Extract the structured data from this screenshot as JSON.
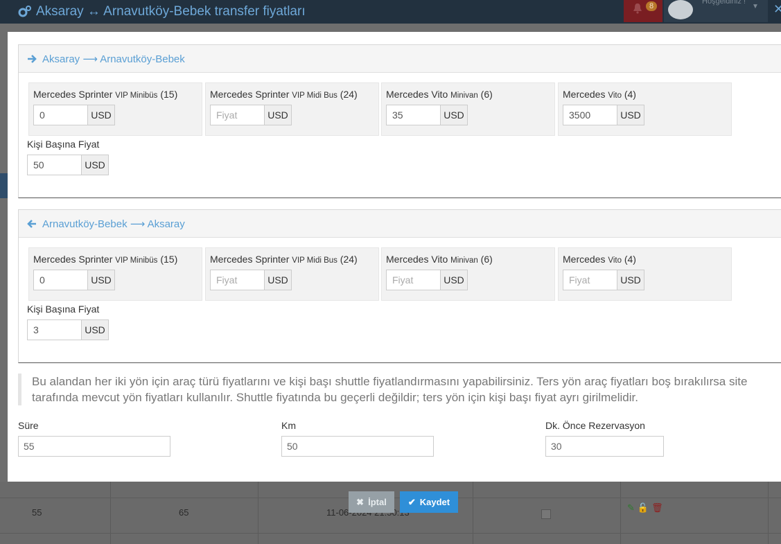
{
  "header": {
    "title": "Aksaray ↔ Arnavutköy-Bebek transfer fiyatları",
    "notification_count": "8",
    "welcome_text": "Hoşgeldiniz !"
  },
  "panels": [
    {
      "direction_label": "Aksaray ⟶ Arnavutköy-Bebek",
      "icon": "arrow-right-icon",
      "vehicles": [
        {
          "name": "Mercedes Sprinter",
          "type": "VIP Minibüs",
          "capacity": "(15)",
          "value": "0",
          "placeholder": "Fiyat",
          "currency": "USD"
        },
        {
          "name": "Mercedes Sprinter",
          "type": "VIP Midi Bus",
          "capacity": "(24)",
          "value": "",
          "placeholder": "Fiyat",
          "currency": "USD"
        },
        {
          "name": "Mercedes Vito",
          "type": "Minivan",
          "capacity": "(6)",
          "value": "35",
          "placeholder": "Fiyat",
          "currency": "USD"
        },
        {
          "name": "Mercedes",
          "type": "Vito",
          "capacity": "(4)",
          "value": "3500",
          "placeholder": "Fiyat",
          "currency": "USD"
        }
      ],
      "per_person_label": "Kişi Başına Fiyat",
      "per_person_value": "50",
      "per_person_currency": "USD"
    },
    {
      "direction_label": "Arnavutköy-Bebek ⟶ Aksaray",
      "icon": "arrow-left-icon",
      "vehicles": [
        {
          "name": "Mercedes Sprinter",
          "type": "VIP Minibüs",
          "capacity": "(15)",
          "value": "0",
          "placeholder": "Fiyat",
          "currency": "USD"
        },
        {
          "name": "Mercedes Sprinter",
          "type": "VIP Midi Bus",
          "capacity": "(24)",
          "value": "",
          "placeholder": "Fiyat",
          "currency": "USD"
        },
        {
          "name": "Mercedes Vito",
          "type": "Minivan",
          "capacity": "(6)",
          "value": "",
          "placeholder": "Fiyat",
          "currency": "USD"
        },
        {
          "name": "Mercedes",
          "type": "Vito",
          "capacity": "(4)",
          "value": "",
          "placeholder": "Fiyat",
          "currency": "USD"
        }
      ],
      "per_person_label": "Kişi Başına Fiyat",
      "per_person_value": "3",
      "per_person_currency": "USD"
    }
  ],
  "note": "Bu alandan her iki yön için araç türü fiyatlarını ve kişi başı shuttle fiyatlandırmasını yapabilirsiniz. Ters yön araç fiyatları boş bırakılırsa site tarafında mevcut yön fiyatları kullanılır. Shuttle fiyatında bu geçerli değildir; ters yön için kişi başı fiyat ayrı girilmelidir.",
  "fields": {
    "duration": {
      "label": "Süre",
      "value": "55"
    },
    "km": {
      "label": "Km",
      "value": "50"
    },
    "advance": {
      "label": "Dk. Önce Rezervasyon",
      "value": "30"
    }
  },
  "buttons": {
    "cancel": "İptal",
    "save": "Kaydet"
  },
  "background_table": {
    "cells": [
      "55",
      "65",
      "11-06-2024 21:50:13"
    ]
  },
  "colors": {
    "accent": "#2f8fd8",
    "link": "#5a9fd4",
    "header_bg": "#22313f"
  }
}
